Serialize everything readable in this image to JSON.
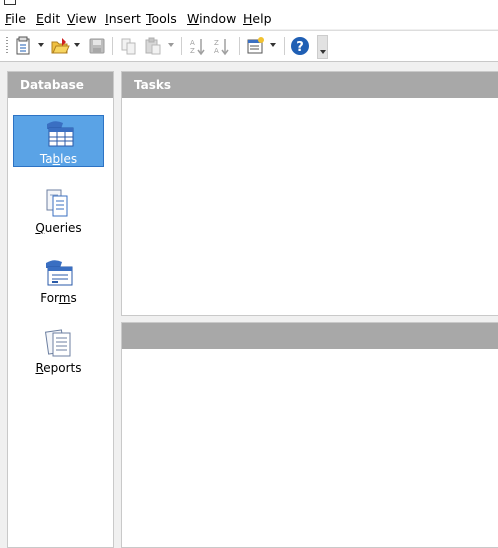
{
  "menubar": {
    "items": [
      {
        "pre": "",
        "u": "F",
        "post": "ile"
      },
      {
        "pre": "",
        "u": "E",
        "post": "dit"
      },
      {
        "pre": "",
        "u": "V",
        "post": "iew"
      },
      {
        "pre": "",
        "u": "I",
        "post": "nsert"
      },
      {
        "pre": "",
        "u": "T",
        "post": "ools"
      },
      {
        "pre": "",
        "u": "W",
        "post": "indow"
      },
      {
        "pre": "",
        "u": "H",
        "post": "elp"
      }
    ]
  },
  "toolbar": {
    "icons": [
      "new-document-icon",
      "open-folder-icon",
      "save-icon",
      "copy-icon",
      "paste-icon",
      "sort-ascending-icon",
      "sort-descending-icon",
      "form-wizard-icon",
      "help-icon",
      "toolbar-overflow-icon"
    ]
  },
  "database_panel": {
    "title": "Database",
    "items": [
      {
        "pre": "Ta",
        "u": "b",
        "post": "les",
        "icon": "tables-icon",
        "selected": true
      },
      {
        "pre": "",
        "u": "Q",
        "post": "ueries",
        "icon": "queries-icon",
        "selected": false
      },
      {
        "pre": "For",
        "u": "m",
        "post": "s",
        "icon": "forms-icon",
        "selected": false
      },
      {
        "pre": "",
        "u": "R",
        "post": "eports",
        "icon": "reports-icon",
        "selected": false
      }
    ]
  },
  "tasks_panel": {
    "title": "Tasks"
  },
  "lower_panel": {
    "title": ""
  },
  "colors": {
    "selection": "#5aa3e6",
    "panel_header": "#a8a8a8",
    "help_blue": "#1f5fb4"
  }
}
